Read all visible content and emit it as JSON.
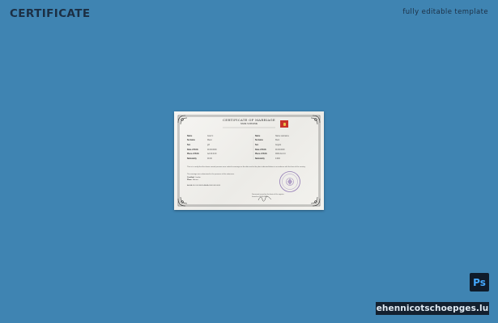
{
  "header": {
    "title": "CERTIFICATE",
    "tagline": "fully editable template"
  },
  "certificate": {
    "heading": "CERTIFICATE OF MARRIAGE",
    "subheading": "NAME SURNAME",
    "colors": {
      "paper": "#f3f2ee",
      "flag": "#c8312a",
      "seal": "#7b5ea8"
    },
    "left_fields": [
      {
        "key": "Name",
        "value": "Jana V."
      },
      {
        "key": "Surname",
        "value": "Meier"
      },
      {
        "key": "Sex",
        "value": "girl"
      },
      {
        "key": "Date of Birth",
        "value": "00.00.0000"
      },
      {
        "key": "Place of Birth",
        "value": "AA.00.0.00"
      },
      {
        "key": "Nationality",
        "value": "00.00"
      }
    ],
    "right_fields": [
      {
        "key": "Name",
        "value": "Name Lastname"
      },
      {
        "key": "Surname",
        "value": "Klein"
      },
      {
        "key": "Sex",
        "value": "Angelo"
      },
      {
        "key": "Date of Birth",
        "value": "00.00.0000"
      },
      {
        "key": "Place of Birth",
        "value": "0000.AA.0.0"
      },
      {
        "key": "Nationality",
        "value": "0.000"
      }
    ],
    "paragraph_1": "This is to certify that the above named persons were united in marriage on the date and at the place indicated below in accordance with the laws of the country.",
    "paragraph_2": "The marriage was solemnized in the presence of the witnesses.",
    "witness_label": "Certified",
    "witness_value": "Jardim",
    "place_label": "Place",
    "place_value": "Bairros",
    "serial": "AA.AA.00.0.00.00000      AA.AA.0000.000.0000",
    "footer_line_1": "Document issued on the basis of the register",
    "footer_line_2": "Issued on 00.00.0000"
  },
  "badges": {
    "ps_label": "Ps",
    "site_url": "ehennicotschoepges.lu"
  }
}
